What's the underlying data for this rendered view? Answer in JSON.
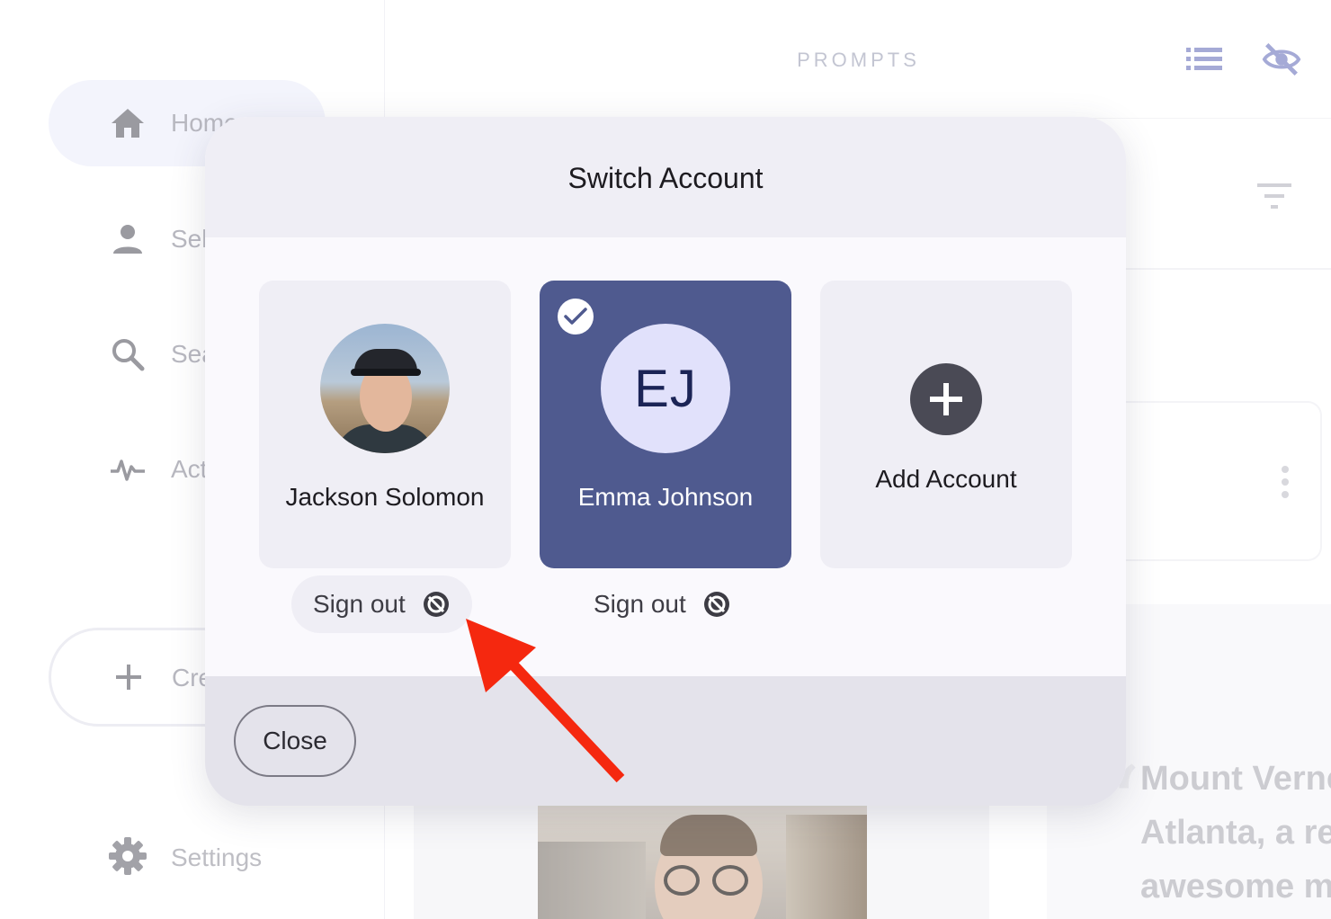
{
  "sidebar": {
    "items": [
      {
        "label": "Home",
        "icon": "home-icon"
      },
      {
        "label": "Sel",
        "icon": "person-icon"
      },
      {
        "label": "Sea",
        "icon": "search-icon"
      },
      {
        "label": "Act",
        "icon": "activity-icon"
      }
    ],
    "create_label": "Cre",
    "settings_label": "Settings"
  },
  "header": {
    "title": "PROMPTS",
    "icons": [
      "list-icon",
      "eye-off-icon",
      "filter-icon"
    ]
  },
  "background": {
    "quote_lines": [
      "Mount Verne",
      "Atlanta, a re",
      "awesome m"
    ]
  },
  "modal": {
    "title": "Switch Account",
    "accounts": [
      {
        "name": "Jackson Solomon",
        "avatar": "photo",
        "selected": false,
        "signout_label": "Sign out"
      },
      {
        "name": "Emma Johnson",
        "initials": "EJ",
        "selected": true,
        "signout_label": "Sign out"
      }
    ],
    "add_account_label": "Add Account",
    "close_label": "Close"
  },
  "colors": {
    "selected_card": "#4f5a8f",
    "card": "#efeef5",
    "initials_bg": "#e1e1fb",
    "annotation_arrow": "#f5280f"
  }
}
